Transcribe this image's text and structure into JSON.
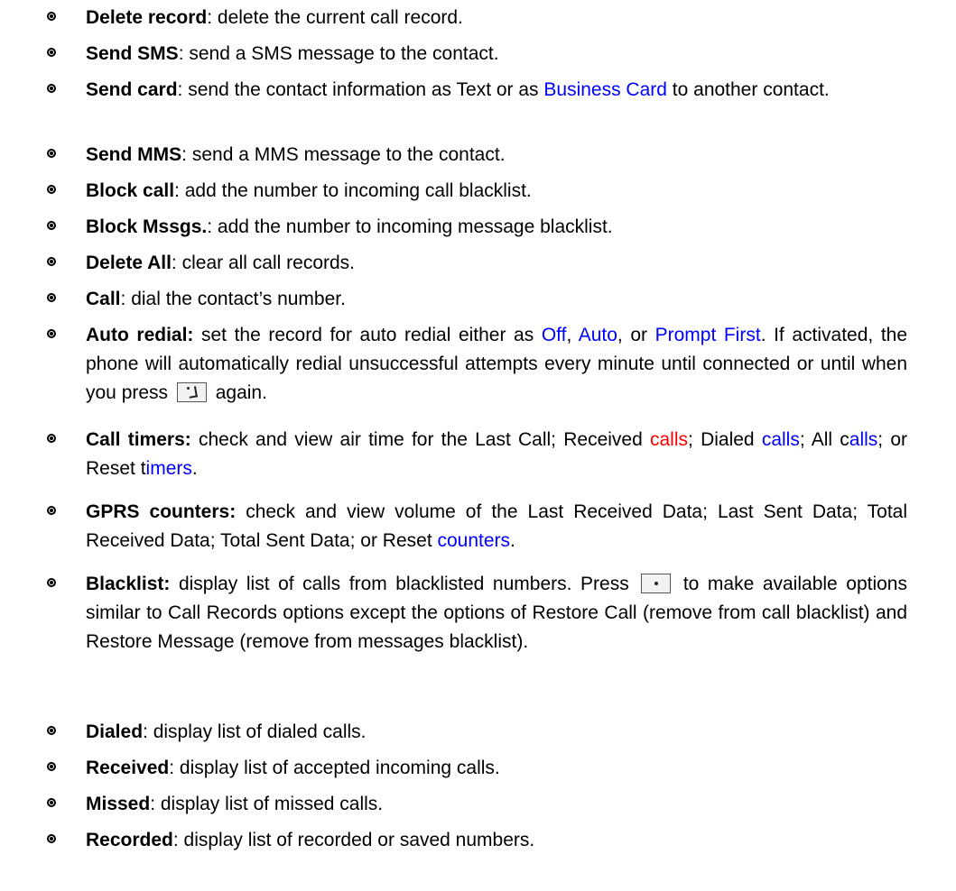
{
  "items": [
    {
      "term": "Delete record",
      "colon": ":",
      "segs": [
        " delete the current call record."
      ]
    },
    {
      "term": "Send SMS",
      "colon": ":",
      "segs": [
        " send a SMS message to the contact."
      ]
    },
    {
      "term": "Send card",
      "colon": ":",
      "segs": [
        " send the contact information as Text or as ",
        "Business Card",
        " to another contact."
      ]
    },
    {
      "term": "Send MMS",
      "colon": ":",
      "segs": [
        " send a MMS message to the contact."
      ]
    },
    {
      "term": "Block call",
      "colon": ":",
      "segs": [
        " add the number to incoming call blacklist."
      ]
    },
    {
      "term": "Block Mssgs.",
      "colon": ":",
      "segs": [
        " add the number to incoming message blacklist."
      ]
    },
    {
      "term": "Delete All",
      "colon": ":",
      "segs": [
        " clear all call records."
      ]
    },
    {
      "term": "Call",
      "colon": ":",
      "segs": [
        " dial the contact’s number."
      ]
    },
    {
      "term": "Auto redial:",
      "segs": [
        " set the record for auto redial either as ",
        "Off",
        ", ",
        "Auto",
        ", or ",
        "Prompt First",
        ". If activated, the phone will automatically redial unsuccessful attempts every minute until connected or until when you press ",
        " again."
      ]
    },
    {
      "term": "Call timers:",
      "segs": [
        " check and view air time for the Last Call; Received ",
        "calls",
        "; Dialed ",
        "calls",
        "; All c",
        "alls",
        "; or Reset t",
        "imers",
        "."
      ]
    },
    {
      "term": "GPRS counters:",
      "segs": [
        " check and view volume of the Last Received Data; Last Sent Data; Total Received Data; Total Sent Data; or Reset ",
        "counters",
        "."
      ]
    },
    {
      "term": "Blacklist:",
      "segs": [
        " display list of calls from blacklisted numbers. Press ",
        " to make available options similar to Call Records options except the options of Restore Call (remove from call blacklist) and Restore Message (remove from messages blacklist)."
      ]
    },
    {
      "term": "Dialed",
      "colon": ":",
      "segs": [
        " display list of dialed calls."
      ]
    },
    {
      "term": "Received",
      "colon": ":",
      "segs": [
        " display list of accepted incoming calls."
      ]
    },
    {
      "term": "Missed",
      "colon": ":",
      "segs": [
        " display list of missed calls."
      ]
    },
    {
      "term": "Recorded",
      "colon": ":",
      "segs": [
        " display list of recorded or saved numbers."
      ]
    }
  ],
  "icons": {
    "call_key": "call-key-icon",
    "center_key": "center-key-icon"
  },
  "colors": {
    "link": "#0000ff",
    "highlight": "#ff0000"
  }
}
